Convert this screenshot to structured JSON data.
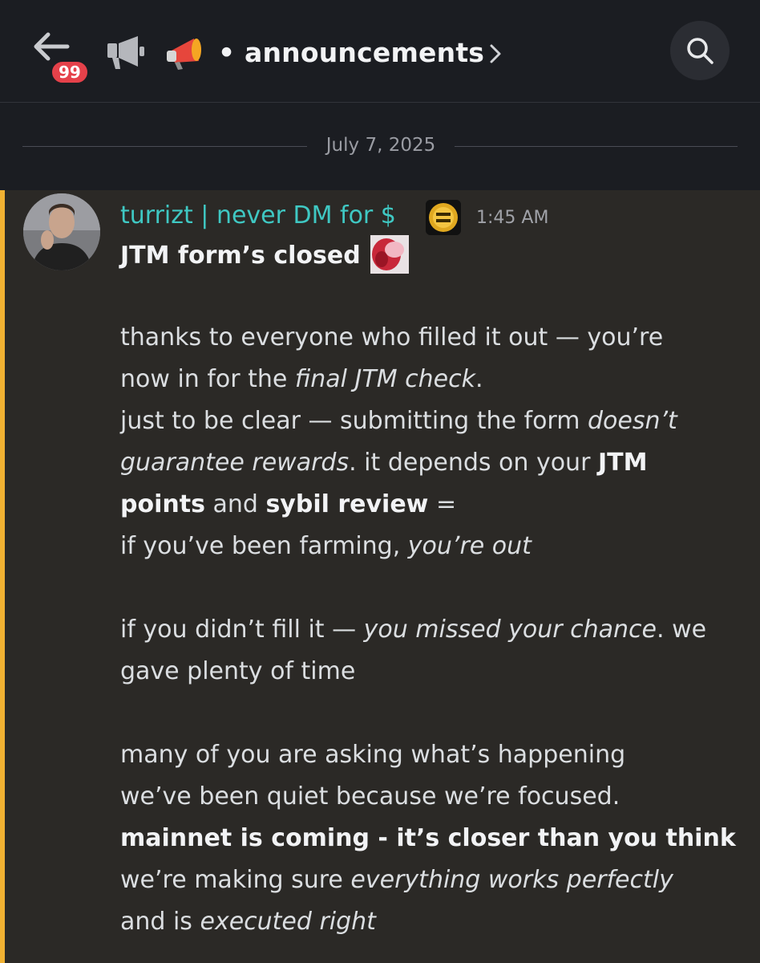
{
  "header": {
    "back_badge": "99",
    "channel_name": "announcements",
    "separator": "•"
  },
  "date_divider": "July 7, 2025",
  "message": {
    "author": "turrizt | never DM for $",
    "time": "1:45 AM",
    "subject": "JTM form’s closed",
    "lines": [
      {
        "segments": [
          {
            "t": "thanks to everyone who filled it out — you’re",
            "s": "n"
          }
        ]
      },
      {
        "segments": [
          {
            "t": "now in for the ",
            "s": "n"
          },
          {
            "t": "final JTM check",
            "s": "i"
          },
          {
            "t": ".",
            "s": "n"
          }
        ]
      },
      {
        "segments": [
          {
            "t": "just to be clear — submitting the form ",
            "s": "n"
          },
          {
            "t": "doesn’t",
            "s": "i"
          }
        ]
      },
      {
        "segments": [
          {
            "t": "guarantee rewards",
            "s": "i"
          },
          {
            "t": ". it depends on your ",
            "s": "n"
          },
          {
            "t": "JTM",
            "s": "b"
          }
        ]
      },
      {
        "segments": [
          {
            "t": "points",
            "s": "b"
          },
          {
            "t": " and ",
            "s": "n"
          },
          {
            "t": "sybil review",
            "s": "b"
          },
          {
            "t": " =",
            "s": "n"
          }
        ]
      },
      {
        "segments": [
          {
            "t": "if you’ve been farming, ",
            "s": "n"
          },
          {
            "t": "you’re out",
            "s": "i"
          }
        ]
      },
      {
        "segments": [
          {
            "t": "if you didn’t fill it — ",
            "s": "n"
          },
          {
            "t": "you missed your chance",
            "s": "i"
          },
          {
            "t": ". we",
            "s": "n"
          }
        ]
      },
      {
        "segments": [
          {
            "t": "gave plenty of time",
            "s": "n"
          }
        ]
      },
      {
        "segments": [
          {
            "t": "many of you are asking what’s happening",
            "s": "n"
          }
        ]
      },
      {
        "segments": [
          {
            "t": "we’ve been quiet because we’re focused.",
            "s": "n"
          }
        ]
      },
      {
        "segments": [
          {
            "t": "mainnet is coming - it’s closer than you think",
            "s": "b"
          }
        ]
      },
      {
        "segments": [
          {
            "t": "we’re making sure ",
            "s": "n"
          },
          {
            "t": "everything works perfectly",
            "s": "i"
          }
        ]
      },
      {
        "segments": [
          {
            "t": "and is ",
            "s": "n"
          },
          {
            "t": "executed right",
            "s": "i"
          }
        ]
      }
    ]
  },
  "icons": {
    "back": "arrow-left-icon",
    "channel": "megaphone-channel-icon",
    "emoji": "megaphone-emoji-icon",
    "chevron": "chevron-right-icon",
    "search": "search-icon"
  },
  "colors": {
    "accent_bar": "#f0b132",
    "username": "#3fc8c3",
    "badge": "#e5414a"
  }
}
